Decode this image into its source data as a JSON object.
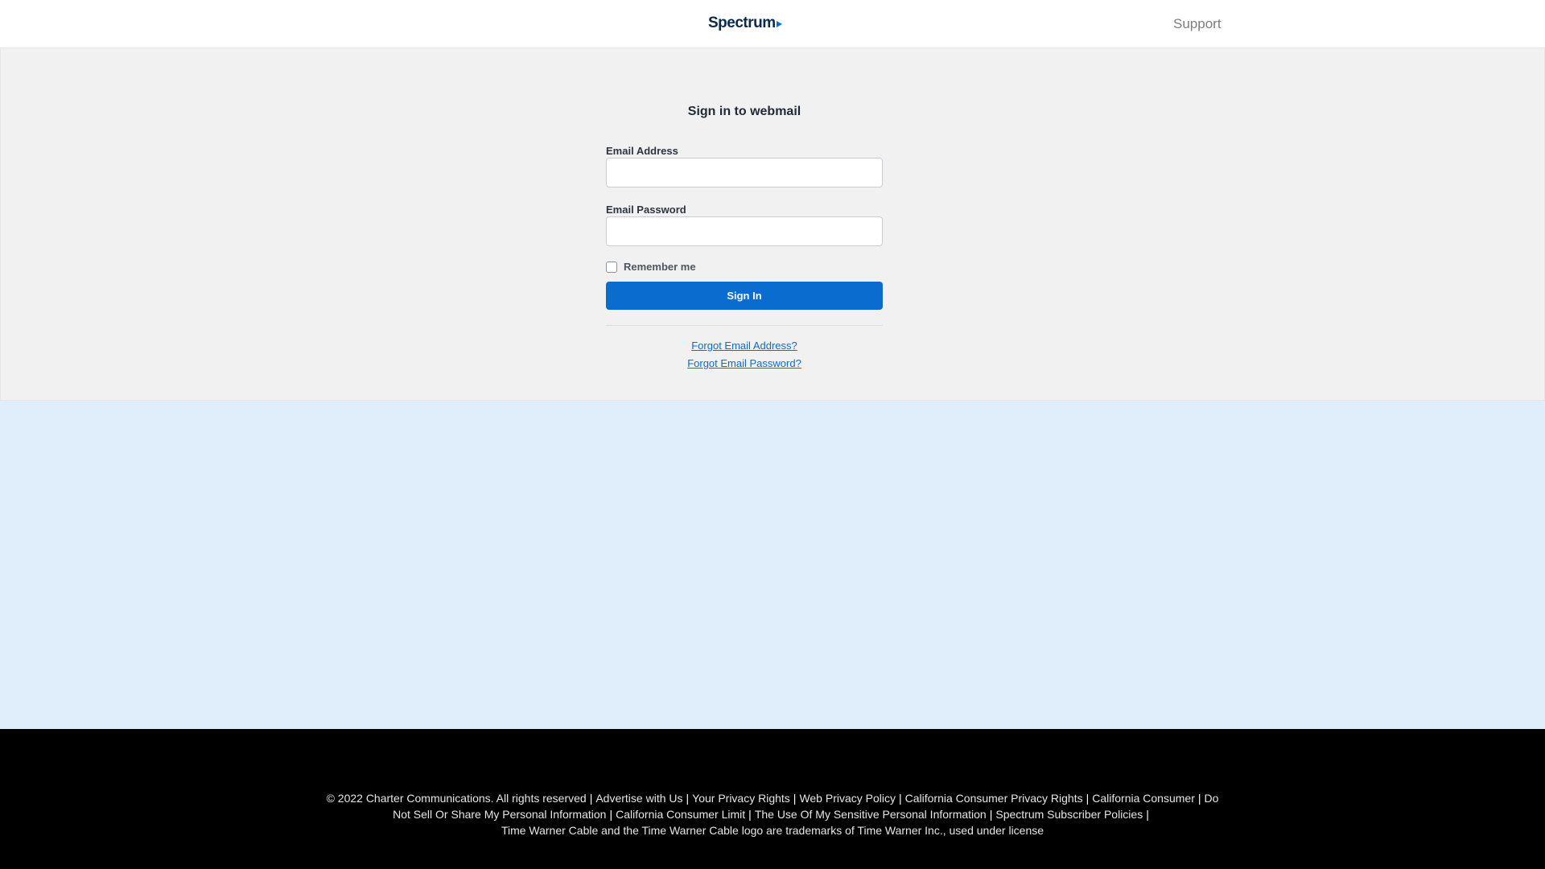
{
  "header": {
    "logo_text": "Spectrum",
    "support_label": "Support"
  },
  "login": {
    "title": "Sign in to webmail",
    "email_label": "Email Address",
    "email_value": "",
    "password_label": "Email Password",
    "password_value": "",
    "remember_label": "Remember me",
    "remember_checked": false,
    "signin_label": "Sign In",
    "forgot_email_label": "Forgot Email Address?",
    "forgot_password_label": "Forgot Email Password?"
  },
  "footer": {
    "links": [
      "© 2022 Charter Communications. All rights reserved",
      "Advertise with Us",
      "Your Privacy Rights",
      "Web Privacy Policy",
      "California Consumer Privacy Rights",
      "California Consumer",
      "Do Not Sell Or Share My Personal Information",
      "California Consumer Limit",
      "The Use Of My Sensitive Personal Information",
      "Spectrum Subscriber Policies"
    ],
    "trademark": "Time Warner Cable and the Time Warner Cable logo are trademarks of Time Warner Inc., used under license"
  },
  "colors": {
    "brand_blue": "#0a6ccf",
    "login_bg": "#f1f1f1",
    "hero_bg": "#dfeefa",
    "footer_bg": "#000000"
  }
}
